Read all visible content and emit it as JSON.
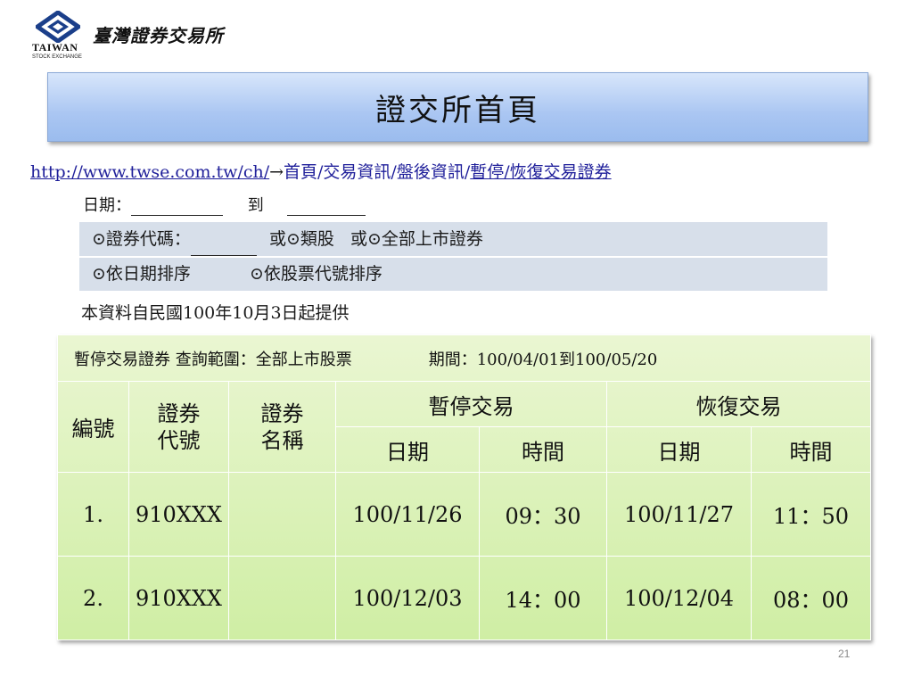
{
  "logo": {
    "en": "TAIWAN",
    "sub": "STOCK EXCHANGE",
    "zh": "臺灣證券交易所"
  },
  "title": "證交所首頁",
  "breadcrumb": {
    "url": "http://www.twse.com.tw/ch/",
    "arrow": "→",
    "path": "首頁/交易資訊/盤後資訊/",
    "last": "暫停/恢復交易證券"
  },
  "date_row": {
    "label": "日期：",
    "to": "到"
  },
  "options": {
    "radio": "⊙",
    "code_label": "證券代碼：",
    "or1": "或",
    "category": "類股",
    "or2": "或",
    "all_listed": "全部上市證券",
    "sort_date": "依日期排序",
    "sort_code": "依股票代號排序"
  },
  "note": "本資料自民國100年10月3日起提供",
  "table": {
    "header_left": "暫停交易證券 查詢範圍：全部上市股票",
    "header_right": "期間：100/04/01到100/05/20",
    "col_no": "編號",
    "col_code_1": "證券",
    "col_code_2": "代號",
    "col_name_1": "證券",
    "col_name_2": "名稱",
    "group_suspend": "暫停交易",
    "group_resume": "恢復交易",
    "sub_date_1": "日期",
    "sub_time_1": "時間",
    "sub_date_2": "日期",
    "sub_time_2": "時間",
    "rows": [
      {
        "no": "1.",
        "code": "910XXX",
        "name": "",
        "s_date": "100/11/26",
        "s_time": "09：30",
        "r_date": "100/11/27",
        "r_time": "11：50"
      },
      {
        "no": "2.",
        "code": "910XXX",
        "name": "",
        "s_date": "100/12/03",
        "s_time": "14：00",
        "r_date": "100/12/04",
        "r_time": "08：00"
      }
    ]
  },
  "page_number": "21"
}
